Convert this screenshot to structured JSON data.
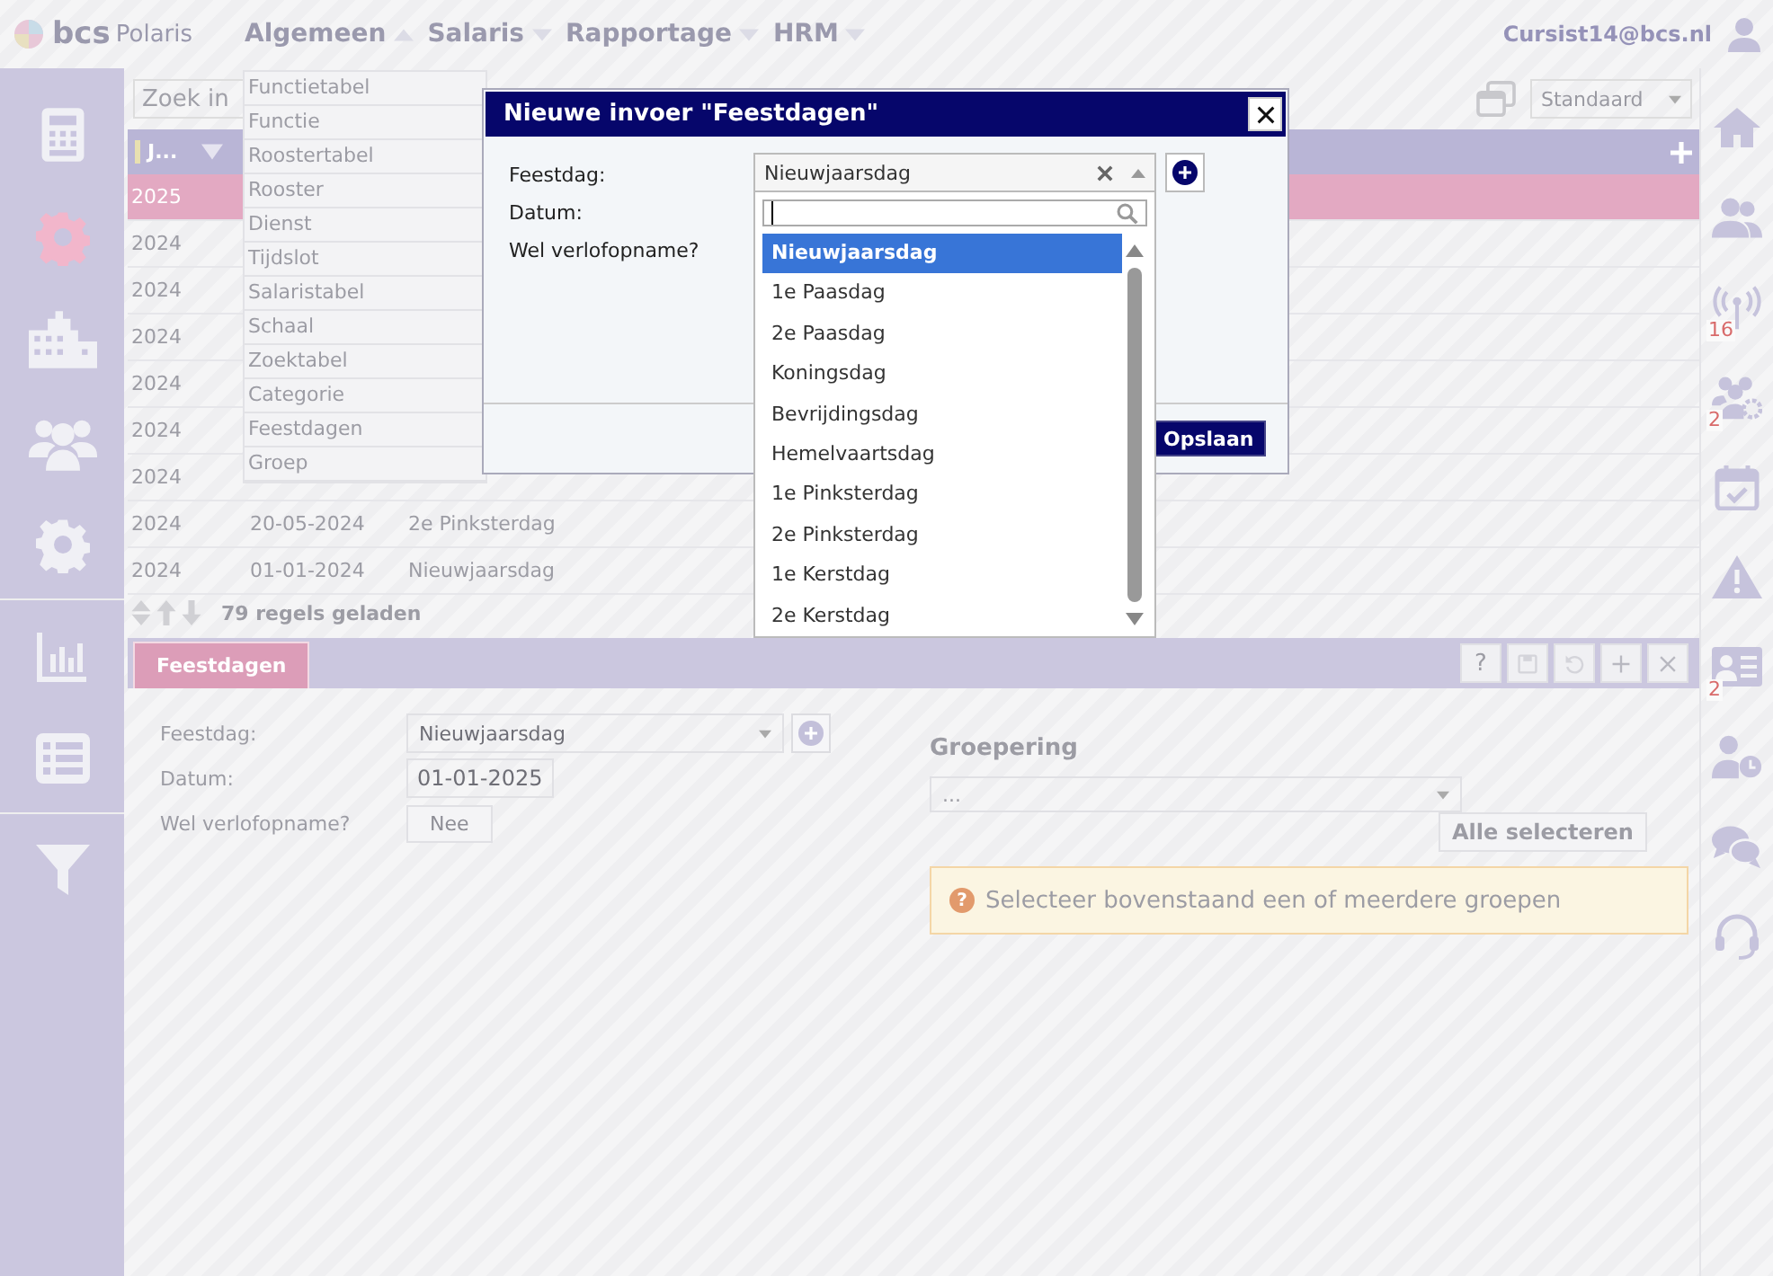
{
  "header": {
    "logo": {
      "brand": "bcs",
      "product": "Polaris"
    },
    "menu": [
      {
        "label": "Algemeen",
        "expanded": true
      },
      {
        "label": "Salaris",
        "expanded": false
      },
      {
        "label": "Rapportage",
        "expanded": false
      },
      {
        "label": "HRM",
        "expanded": false
      }
    ],
    "user": "Cursist14@bcs.nl"
  },
  "left_nav": [
    {
      "kind": "calc",
      "selected": false
    },
    {
      "kind": "gear",
      "selected": true
    },
    {
      "kind": "building",
      "selected": false
    },
    {
      "kind": "people",
      "selected": false
    },
    {
      "kind": "cog",
      "selected": false
    },
    {
      "kind": "chart",
      "selected": false
    },
    {
      "kind": "list",
      "selected": false
    },
    {
      "kind": "filter",
      "selected": false
    }
  ],
  "right_nav": [
    {
      "kind": "home"
    },
    {
      "kind": "people"
    },
    {
      "kind": "antenna",
      "badge": "16"
    },
    {
      "kind": "peoplegear",
      "badge": "2"
    },
    {
      "kind": "calendar"
    },
    {
      "kind": "warning"
    },
    {
      "kind": "card",
      "badge": "2"
    },
    {
      "kind": "personclock"
    },
    {
      "kind": "chat"
    },
    {
      "kind": "headset"
    }
  ],
  "general_menu": [
    "Functietabel",
    "Functie",
    "Roostertabel",
    "Rooster",
    "Dienst",
    "Tijdslot",
    "Salaristabel",
    "Schaal",
    "Zoektabel",
    "Categorie",
    "Feestdagen",
    "Groep"
  ],
  "toolbar": {
    "search_placeholder": "Zoek in",
    "view": "Standaard"
  },
  "table": {
    "columns": [
      "J..."
    ],
    "rows": [
      {
        "year": "2025",
        "selected": true
      },
      {
        "year": "2024",
        "selected": false
      },
      {
        "year": "2024",
        "selected": false
      },
      {
        "year": "2024",
        "selected": false
      },
      {
        "year": "2024",
        "selected": false
      },
      {
        "year": "2024",
        "selected": false
      },
      {
        "year": "2024",
        "selected": false
      },
      {
        "year": "2024",
        "date": "20-05-2024",
        "name": "2e Pinksterdag",
        "selected": false
      },
      {
        "year": "2024",
        "date": "01-01-2024",
        "name": "Nieuwjaarsdag",
        "selected": false
      }
    ],
    "footer": "79 regels geladen"
  },
  "detail_panel": {
    "tab": "Feestdagen",
    "help": "?",
    "fields": [
      {
        "label": "Feestdag:",
        "kind": "select",
        "value": "Nieuwjaarsdag"
      },
      {
        "label": "Datum:",
        "kind": "date",
        "value": "01-01-2025"
      },
      {
        "label": "Wel verlofopname?",
        "kind": "toggle",
        "value": "Nee"
      }
    ],
    "grouping": {
      "title": "Groepering",
      "placeholder": "...",
      "select_all": "Alle selecteren",
      "notice_icon": "?",
      "notice": "Selecteer bovenstaand een of meerdere groepen"
    }
  },
  "dialog": {
    "title": "Nieuwe invoer \"Feestdagen\"",
    "labels": [
      "Feestdag:",
      "Datum:",
      "Wel verlofopname?"
    ],
    "select": {
      "value": "Nieuwjaarsdag",
      "options": [
        {
          "label": "Nieuwjaarsdag",
          "selected": true
        },
        {
          "label": "1e Paasdag",
          "selected": false
        },
        {
          "label": "2e Paasdag",
          "selected": false
        },
        {
          "label": "Koningsdag",
          "selected": false
        },
        {
          "label": "Bevrijdingsdag",
          "selected": false
        },
        {
          "label": "Hemelvaartsdag",
          "selected": false
        },
        {
          "label": "1e Pinksterdag",
          "selected": false
        },
        {
          "label": "2e Pinksterdag",
          "selected": false
        },
        {
          "label": "1e Kerstdag",
          "selected": false
        },
        {
          "label": "2e Kerstdag",
          "selected": false
        }
      ]
    },
    "save": "Opslaan"
  }
}
